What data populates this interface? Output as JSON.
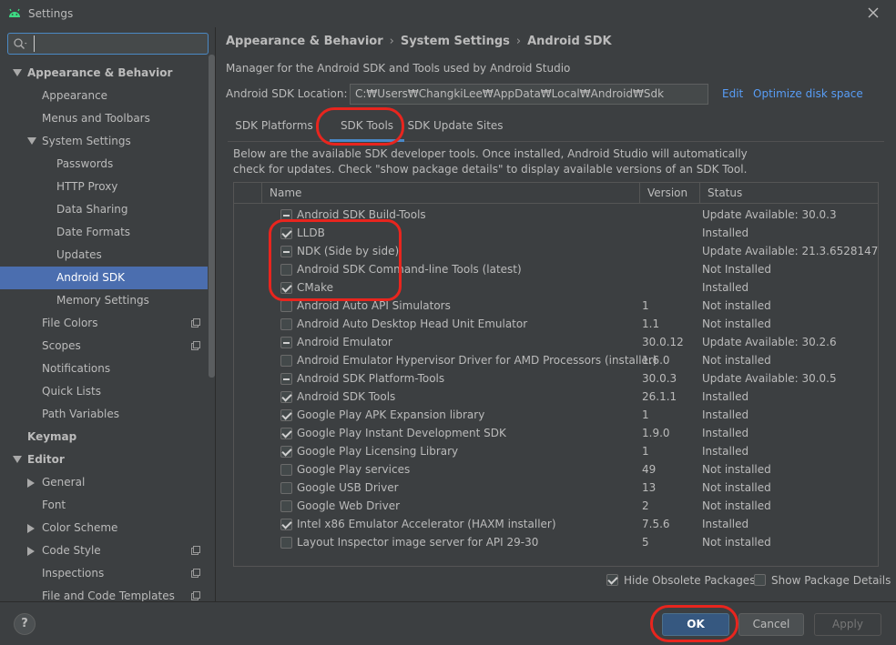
{
  "window": {
    "title": "Settings"
  },
  "search": {
    "placeholder": "",
    "value": ""
  },
  "sidebar": {
    "items": [
      {
        "label": "Appearance & Behavior",
        "level": 0,
        "arrow": "down",
        "bold": true
      },
      {
        "label": "Appearance",
        "level": 1
      },
      {
        "label": "Menus and Toolbars",
        "level": 1
      },
      {
        "label": "System Settings",
        "level": 1,
        "arrow": "down"
      },
      {
        "label": "Passwords",
        "level": 2
      },
      {
        "label": "HTTP Proxy",
        "level": 2
      },
      {
        "label": "Data Sharing",
        "level": 2
      },
      {
        "label": "Date Formats",
        "level": 2
      },
      {
        "label": "Updates",
        "level": 2
      },
      {
        "label": "Android SDK",
        "level": 2,
        "selected": true
      },
      {
        "label": "Memory Settings",
        "level": 2
      },
      {
        "label": "File Colors",
        "level": 1,
        "project": true
      },
      {
        "label": "Scopes",
        "level": 1,
        "project": true
      },
      {
        "label": "Notifications",
        "level": 1
      },
      {
        "label": "Quick Lists",
        "level": 1
      },
      {
        "label": "Path Variables",
        "level": 1
      },
      {
        "label": "Keymap",
        "level": 0,
        "bold": true
      },
      {
        "label": "Editor",
        "level": 0,
        "arrow": "down",
        "bold": true
      },
      {
        "label": "General",
        "level": 1,
        "arrow": "right"
      },
      {
        "label": "Font",
        "level": 1
      },
      {
        "label": "Color Scheme",
        "level": 1,
        "arrow": "right"
      },
      {
        "label": "Code Style",
        "level": 1,
        "arrow": "right",
        "project": true
      },
      {
        "label": "Inspections",
        "level": 1,
        "project": true
      },
      {
        "label": "File and Code Templates",
        "level": 1,
        "project": true
      }
    ]
  },
  "breadcrumb": [
    "Appearance & Behavior",
    "System Settings",
    "Android SDK"
  ],
  "breadcrumb_sep": "›",
  "description": "Manager for the Android SDK and Tools used by Android Studio",
  "sdk_location": {
    "label": "Android SDK Location:",
    "value": "C:₩Users₩ChangkiLee₩AppData₩Local₩Android₩Sdk",
    "edit_label": "Edit",
    "optimize_label": "Optimize disk space"
  },
  "tabs": [
    {
      "label": "SDK Platforms",
      "active": false
    },
    {
      "label": "SDK Tools",
      "active": true
    },
    {
      "label": "SDK Update Sites",
      "active": false
    }
  ],
  "info_text": "Below are the available SDK developer tools. Once installed, Android Studio will automatically check for updates. Check \"show package details\" to display available versions of an SDK Tool.",
  "table": {
    "columns": [
      "Name",
      "Version",
      "Status"
    ],
    "rows": [
      {
        "name": "Android SDK Build-Tools",
        "version": "",
        "status": "Update Available: 30.0.3",
        "state": "partial"
      },
      {
        "name": "LLDB",
        "version": "",
        "status": "Installed",
        "state": "checked"
      },
      {
        "name": "NDK (Side by side)",
        "version": "",
        "status": "Update Available: 21.3.6528147",
        "state": "partial"
      },
      {
        "name": "Android SDK Command-line Tools (latest)",
        "version": "",
        "status": "Not Installed",
        "state": "unchecked"
      },
      {
        "name": "CMake",
        "version": "",
        "status": "Installed",
        "state": "checked"
      },
      {
        "name": "Android Auto API Simulators",
        "version": "1",
        "status": "Not installed",
        "state": "unchecked"
      },
      {
        "name": "Android Auto Desktop Head Unit Emulator",
        "version": "1.1",
        "status": "Not installed",
        "state": "unchecked"
      },
      {
        "name": "Android Emulator",
        "version": "30.0.12",
        "status": "Update Available: 30.2.6",
        "state": "partial"
      },
      {
        "name": "Android Emulator Hypervisor Driver for AMD Processors (installer)",
        "version": "1.6.0",
        "status": "Not installed",
        "state": "unchecked"
      },
      {
        "name": "Android SDK Platform-Tools",
        "version": "30.0.3",
        "status": "Update Available: 30.0.5",
        "state": "partial"
      },
      {
        "name": "Android SDK Tools",
        "version": "26.1.1",
        "status": "Installed",
        "state": "checked"
      },
      {
        "name": "Google Play APK Expansion library",
        "version": "1",
        "status": "Installed",
        "state": "checked"
      },
      {
        "name": "Google Play Instant Development SDK",
        "version": "1.9.0",
        "status": "Installed",
        "state": "checked"
      },
      {
        "name": "Google Play Licensing Library",
        "version": "1",
        "status": "Installed",
        "state": "checked"
      },
      {
        "name": "Google Play services",
        "version": "49",
        "status": "Not installed",
        "state": "unchecked"
      },
      {
        "name": "Google USB Driver",
        "version": "13",
        "status": "Not installed",
        "state": "unchecked"
      },
      {
        "name": "Google Web Driver",
        "version": "2",
        "status": "Not installed",
        "state": "unchecked"
      },
      {
        "name": "Intel x86 Emulator Accelerator (HAXM installer)",
        "version": "7.5.6",
        "status": "Installed",
        "state": "checked"
      },
      {
        "name": "Layout Inspector image server for API 29-30",
        "version": "5",
        "status": "Not installed",
        "state": "unchecked"
      }
    ]
  },
  "options": {
    "hide_obsolete": {
      "label": "Hide Obsolete Packages",
      "checked": true
    },
    "show_details": {
      "label": "Show Package Details",
      "checked": false
    }
  },
  "footer": {
    "help_label": "?",
    "ok_label": "OK",
    "cancel_label": "Cancel",
    "apply_label": "Apply"
  },
  "colors": {
    "accent": "#4b6eaf",
    "link": "#589df6",
    "highlight": "#e8251e",
    "primary_button": "#365880"
  }
}
